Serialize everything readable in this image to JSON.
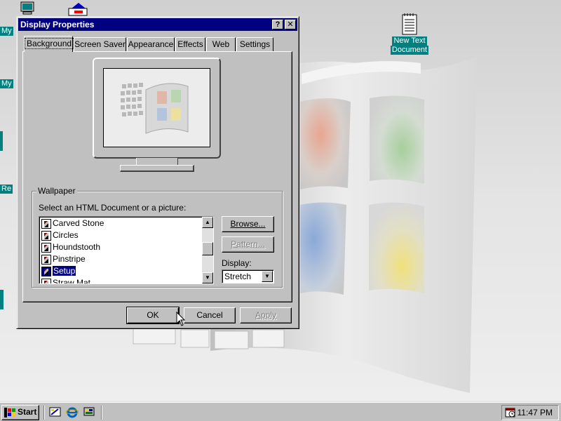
{
  "desktop": {
    "icons": [
      {
        "label": "My",
        "name": "my-computer-icon"
      },
      {
        "label": "My",
        "name": "my-documents-icon"
      },
      {
        "label": "Re",
        "name": "recycle-bin-icon"
      },
      {
        "label": "New Text\nDocument",
        "line1": "New Text",
        "line2": "Document",
        "name": "text-document-icon"
      }
    ]
  },
  "window": {
    "title": "Display Properties",
    "help_button": "?",
    "close_button": "✕",
    "tabs": [
      {
        "label": "Background",
        "active": true
      },
      {
        "label": "Screen Saver"
      },
      {
        "label": "Appearance"
      },
      {
        "label": "Effects"
      },
      {
        "label": "Web"
      },
      {
        "label": "Settings"
      }
    ],
    "wallpaper": {
      "group_label": "Wallpaper",
      "prompt": "Select an HTML Document or a picture:",
      "items": [
        {
          "label": "Carved Stone"
        },
        {
          "label": "Circles"
        },
        {
          "label": "Houndstooth"
        },
        {
          "label": "Pinstripe"
        },
        {
          "label": "Setup",
          "selected": true
        },
        {
          "label": "Straw Mat"
        }
      ],
      "browse_label": "Browse...",
      "pattern_label": "Pattern...",
      "display_label": "Display:",
      "display_value": "Stretch"
    },
    "buttons": {
      "ok": "OK",
      "cancel": "Cancel",
      "apply": "Apply"
    }
  },
  "taskbar": {
    "start_label": "Start",
    "clock": "11:47 PM",
    "quicklaunch": [
      "desktop-icon",
      "internet-explorer-icon",
      "channels-icon"
    ]
  },
  "colors": {
    "titlebar": "#000080",
    "selection": "#000080",
    "face": "#c0c0c0",
    "desktop_label_bg": "#008080"
  }
}
